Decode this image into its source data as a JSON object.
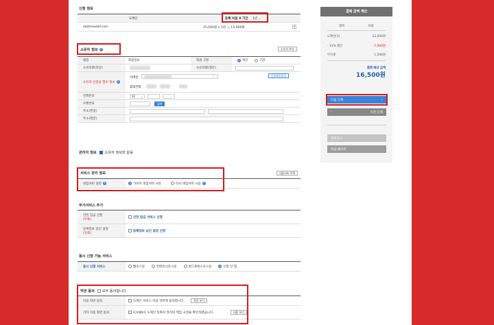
{
  "domain": "Computer-Use",
  "apply_info": {
    "title": "신청 정보",
    "col_domain": "도메인",
    "col_period": "등록 비용 X 기간",
    "period_select": "1년",
    "domain_value": "abatrowekf.com",
    "price_value": "15,000원 x 1년",
    "price_total": "= 15,000원"
  },
  "owner": {
    "title": "소유자 정보",
    "copy_btn": "소유자 복사",
    "row_name": "법칭",
    "row_name_value": "회원정보",
    "row_member_type": "회원 구분",
    "radio_individual": "개인",
    "radio_org": "기관",
    "row_kor_name": "소유자명(한글)",
    "row_eng_name": "소유자명(영문)",
    "row_auth": "소유자 인증용 필수 정보",
    "email_label": "이메일",
    "phone_label": "휴대전화",
    "verify_btn": "인증메일발송",
    "row_phone": "전화번호",
    "phone_prefix": "02",
    "row_zip": "우편번호",
    "zip_btn": "검색",
    "row_addr_kor": "주소(한글)",
    "row_addr_eng": "주소(영문)"
  },
  "admin": {
    "title": "관리자 정보",
    "same_label": "소유자 정보와 같음"
  },
  "service": {
    "title": "서비스 관리 정보",
    "copy_btn": "네임서버 목록",
    "row_ns": "네임서버 설정",
    "ns_option1": "가비아 네임서버 사용",
    "ns_option2": "타사 네임서버 사용"
  },
  "addon": {
    "title": "부가서비스 추가",
    "row_lock": "안전 잠금 신청",
    "row_lock_sub": "(무료)",
    "lock_value": "안전 잠금 서비스 신청",
    "row_approve": "등록정보 승인 설정",
    "row_approve_sub": "(유료)",
    "approve_value": "등록정보 승인 설정 신청"
  },
  "concurrent": {
    "title": "동시 신청 가능 서비스",
    "row_label": "동시 신청 서비스",
    "opt1": "웹호스팅",
    "opt2": "컨테이너호스팅",
    "opt3": "워드프레스호스팅",
    "opt4": "신청 안 함"
  },
  "terms": {
    "title": "약관 동의",
    "all_agree": "모두 동의합니다.",
    "row_terms": "이용 약관 동의",
    "terms_text": "도메인 서비스 이용 약관에 동의합니다.",
    "terms_btn": "약관 보기",
    "row_other": "기타 이용 약관 동의",
    "other_text": "ICANN의 도메인 등록자 권리와 책임 규정을 확인하였습니다.",
    "other_btn": "내용 보기"
  },
  "summary": {
    "title": "결제 금액 계산",
    "col_item": "항목",
    "col_cost": "비용",
    "line1_label": "도메인(1)",
    "line1_value": "22,000원",
    "line2_label": "- 31% 할인",
    "line2_value": "-7,000원",
    "line3_label": "부가세",
    "line3_value": "1,500원",
    "total_label": "결제 예상 금액",
    "total_value": "16,500원",
    "next_btn": "다음 단계",
    "prev_btn": "이전 단계",
    "gray_btn1": "장바구니",
    "gray_btn2": "처음 페이지"
  }
}
